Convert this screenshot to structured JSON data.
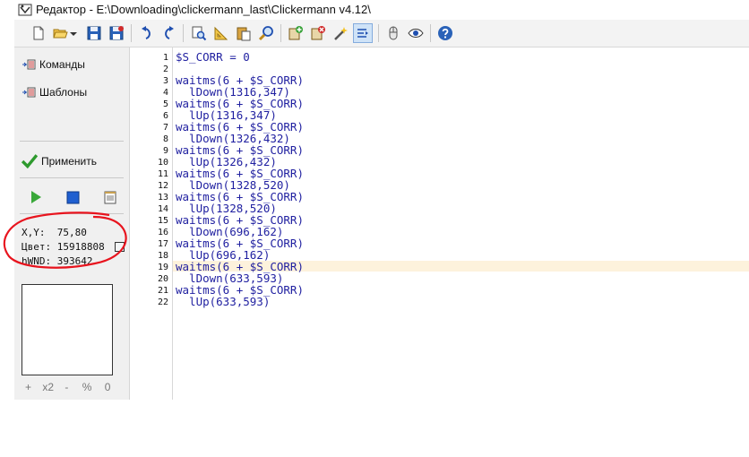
{
  "window": {
    "title": "Редактор - E:\\Downloading\\clickermann_last\\Clickermann v4.12\\"
  },
  "toolbar": {
    "buttons": [
      {
        "icon": "new-file-icon"
      },
      {
        "icon": "open-folder-icon"
      },
      {
        "icon": "dropdown-arrow-icon"
      },
      {
        "icon": "save-icon"
      },
      {
        "icon": "save-all-icon"
      },
      {
        "icon": "undo-icon"
      },
      {
        "icon": "redo-icon"
      },
      {
        "icon": "find-icon"
      },
      {
        "icon": "ruler-icon"
      },
      {
        "icon": "paste-icon"
      },
      {
        "icon": "search-icon"
      },
      {
        "icon": "add-icon"
      },
      {
        "icon": "delete-icon"
      },
      {
        "icon": "magic-wand-icon"
      },
      {
        "icon": "format-icon"
      },
      {
        "icon": "mouse-icon"
      },
      {
        "icon": "eye-icon"
      },
      {
        "icon": "help-icon"
      }
    ]
  },
  "sidebar": {
    "commands_label": "Команды",
    "templates_label": "Шаблоны",
    "apply_label": "Применить"
  },
  "info": {
    "xy_label": "X,Y:",
    "xy_value": "75,80",
    "color_label": "Цвет:",
    "color_value": "15918808",
    "hwnd_label": "hWND:",
    "hwnd_value": "393642"
  },
  "zoom": {
    "plus": "+",
    "x2": "x2",
    "minus": "-",
    "percent": "%",
    "zero": "0"
  },
  "editor": {
    "highlighted_line": 19,
    "lines": [
      {
        "no": "1",
        "text": "$S_CORR = 0"
      },
      {
        "no": "2",
        "text": ""
      },
      {
        "no": "3",
        "text": "waitms(6 + $S_CORR)"
      },
      {
        "no": "4",
        "text": "  lDown(1316,347)"
      },
      {
        "no": "5",
        "text": "waitms(6 + $S_CORR)"
      },
      {
        "no": "6",
        "text": "  lUp(1316,347)"
      },
      {
        "no": "7",
        "text": "waitms(6 + $S_CORR)"
      },
      {
        "no": "8",
        "text": "  lDown(1326,432)"
      },
      {
        "no": "9",
        "text": "waitms(6 + $S_CORR)"
      },
      {
        "no": "10",
        "text": "  lUp(1326,432)"
      },
      {
        "no": "11",
        "text": "waitms(6 + $S_CORR)"
      },
      {
        "no": "12",
        "text": "  lDown(1328,520)"
      },
      {
        "no": "13",
        "text": "waitms(6 + $S_CORR)"
      },
      {
        "no": "14",
        "text": "  lUp(1328,520)"
      },
      {
        "no": "15",
        "text": "waitms(6 + $S_CORR)"
      },
      {
        "no": "16",
        "text": "  lDown(696,162)"
      },
      {
        "no": "17",
        "text": "waitms(6 + $S_CORR)"
      },
      {
        "no": "18",
        "text": "  lUp(696,162)"
      },
      {
        "no": "19",
        "text": "waitms(6 + $S_CORR)"
      },
      {
        "no": "20",
        "text": "  lDown(633,593)"
      },
      {
        "no": "21",
        "text": "waitms(6 + $S_CORR)"
      },
      {
        "no": "22",
        "text": "  lUp(633,593)"
      }
    ]
  }
}
